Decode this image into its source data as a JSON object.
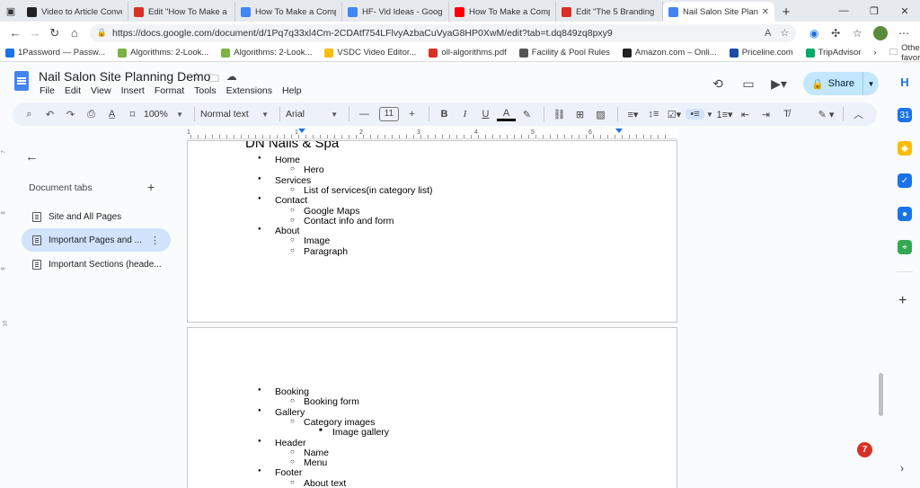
{
  "browser": {
    "tabs": [
      {
        "title": "Video to Article Conve",
        "color": "#222222"
      },
      {
        "title": "Edit \"How To Make a C",
        "color": "#d93025"
      },
      {
        "title": "How To Make a Compl",
        "color": "#4285f4"
      },
      {
        "title": "HF- Vid Ideas - Google",
        "color": "#4285f4"
      },
      {
        "title": "How To Make a Compl",
        "color": "#ff0000"
      },
      {
        "title": "Edit \"The 5 Branding C",
        "color": "#d93025"
      },
      {
        "title": "Nail Salon Site Plannin",
        "color": "#4285f4"
      }
    ],
    "url": "https://docs.google.com/document/d/1Pq7q33xl4Cm-2CDAtf754LFlvyAzbaCuVyaG8HP0XwM/edit?tab=t.dq849zq8pxy9",
    "bookmarks": [
      {
        "label": "1Password — Passw...",
        "color": "#1a73e8"
      },
      {
        "label": "Algorithms: 2-Look...",
        "color": "#7cb342"
      },
      {
        "label": "Algorithms: 2-Look...",
        "color": "#7cb342"
      },
      {
        "label": "VSDC Video Editor...",
        "color": "#fbbc04"
      },
      {
        "label": "oll-algorithms.pdf",
        "color": "#d93025"
      },
      {
        "label": "Facility & Pool Rules",
        "color": "#555555"
      },
      {
        "label": "Amazon.com – Onli...",
        "color": "#222222"
      },
      {
        "label": "Priceline.com",
        "color": "#1a4ba6"
      },
      {
        "label": "TripAdvisor",
        "color": "#00aa6c"
      }
    ],
    "other_favorites": "Other favorites"
  },
  "docs": {
    "title": "Nail Salon Site Planning Demo",
    "menu": [
      "File",
      "Edit",
      "View",
      "Insert",
      "Format",
      "Tools",
      "Extensions",
      "Help"
    ],
    "share_label": "Share",
    "toolbar": {
      "zoom": "100%",
      "style": "Normal text",
      "font": "Arial",
      "font_size": "11"
    },
    "ruler_numbers": [
      "1",
      "1",
      "2",
      "3",
      "4",
      "5",
      "6"
    ],
    "vruler_numbers": [
      "7",
      "8",
      "9",
      "10"
    ]
  },
  "sidebar": {
    "title": "Document tabs",
    "tabs": [
      {
        "label": "Site and All Pages"
      },
      {
        "label": "Important Pages and ..."
      },
      {
        "label": "Important Sections (heade..."
      }
    ]
  },
  "page1": {
    "heading": "DN Nails & Spa",
    "items": [
      {
        "level": 1,
        "text": "Home"
      },
      {
        "level": 2,
        "text": "Hero"
      },
      {
        "level": 1,
        "text": "Services"
      },
      {
        "level": 2,
        "text": "List of services(in category list)"
      },
      {
        "level": 1,
        "text": "Contact"
      },
      {
        "level": 2,
        "text": "Google Maps"
      },
      {
        "level": 2,
        "text": "Contact info and form"
      },
      {
        "level": 1,
        "text": "About"
      },
      {
        "level": 2,
        "text": "Image"
      },
      {
        "level": 2,
        "text": "Paragraph"
      }
    ]
  },
  "page2": {
    "items": [
      {
        "level": 1,
        "text": "Booking"
      },
      {
        "level": 2,
        "text": "Booking form"
      },
      {
        "level": 1,
        "text": "Gallery"
      },
      {
        "level": 2,
        "text": "Category images"
      },
      {
        "level": 3,
        "text": "Image gallery"
      },
      {
        "level": 1,
        "text": "Header"
      },
      {
        "level": 2,
        "text": "Name"
      },
      {
        "level": 2,
        "text": "Menu"
      },
      {
        "level": 1,
        "text": "Footer"
      },
      {
        "level": 2,
        "text": "About text"
      }
    ]
  },
  "notification_count": "7"
}
